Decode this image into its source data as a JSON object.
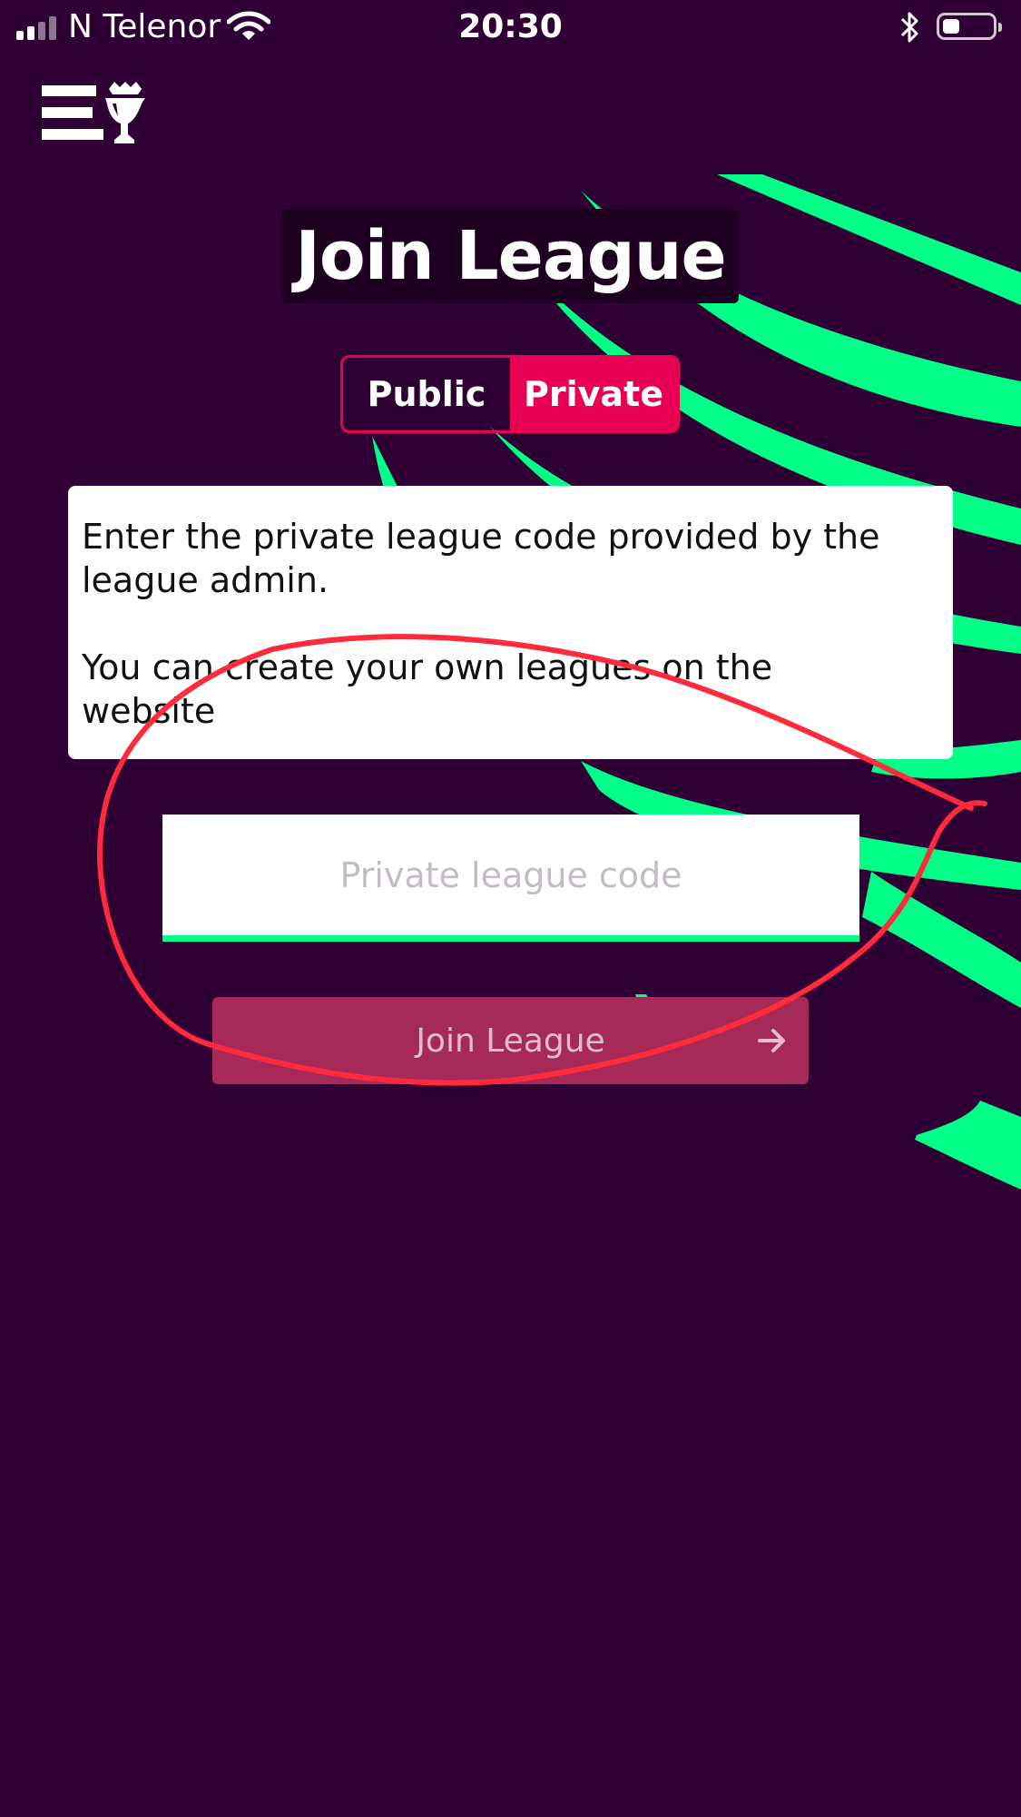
{
  "status_bar": {
    "carrier": "N Telenor",
    "time": "20:30",
    "battery_level": 0.35
  },
  "header": {
    "menu_icon": "hamburger-menu-icon",
    "logo_icon": "trophy-lion-logo"
  },
  "page": {
    "title": "Join League"
  },
  "tabs": [
    {
      "label": "Public",
      "active": false
    },
    {
      "label": "Private",
      "active": true
    }
  ],
  "info": {
    "line1": "Enter the private league code provided by the league admin.",
    "line2": "You can create your own leagues on the website"
  },
  "code_input": {
    "placeholder": "Private league code",
    "value": ""
  },
  "join_button": {
    "label": "Join League",
    "icon": "arrow-right-icon",
    "disabled": true
  },
  "colors": {
    "background": "#2f0034",
    "accent_pink": "#e90052",
    "accent_green": "#00ff87",
    "annotation_red": "#ff2a3c"
  }
}
